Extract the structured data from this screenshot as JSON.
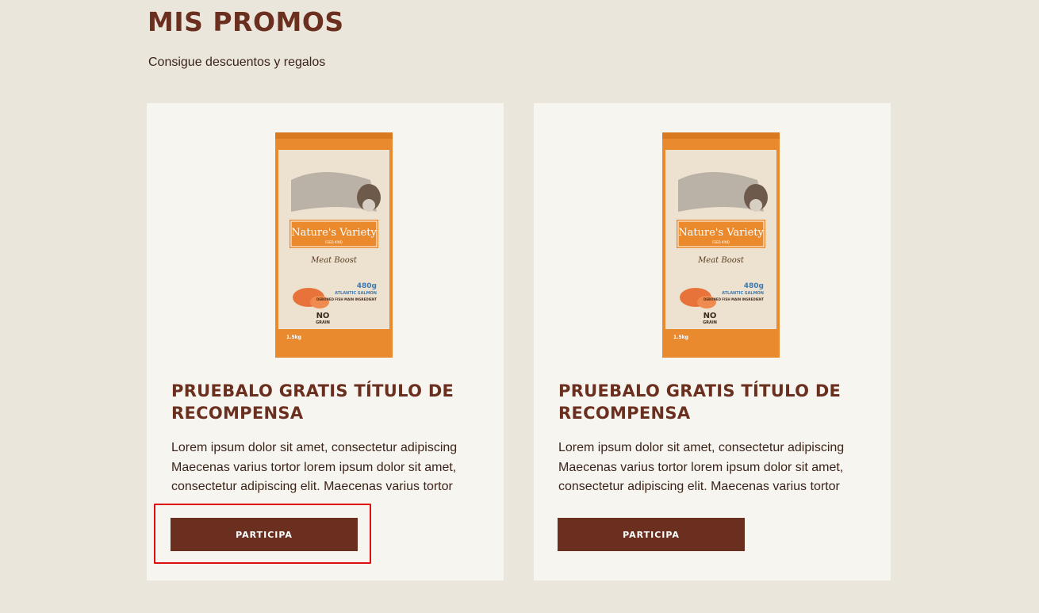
{
  "header": {
    "title": "MIS PROMOS",
    "subtitle": "Consigue descuentos y regalos"
  },
  "promos": [
    {
      "title": "PRUEBALO GRATIS TÍTULO DE RECOMPENSA",
      "description": "Lorem ipsum dolor sit amet, consectetur adipiscing Maecenas varius tortor lorem ipsum dolor sit amet, consectetur adipiscing elit. Maecenas varius tortor",
      "button_label": "PARTICIPA",
      "product": {
        "brand": "Nature's Variety",
        "sub_brand": "FEED KIND",
        "line": "Meat Boost",
        "weight": "480g",
        "protein": "ATLANTIC SALMON",
        "claim": "DEBONED FISH MAIN INGREDIENT",
        "no_grain_top": "NO",
        "no_grain_bottom": "GRAIN",
        "net": "1.5kg"
      }
    },
    {
      "title": "PRUEBALO GRATIS TÍTULO DE RECOMPENSA",
      "description": "Lorem ipsum dolor sit amet, consectetur adipiscing Maecenas varius tortor lorem ipsum dolor sit amet, consectetur adipiscing elit. Maecenas varius tortor",
      "button_label": "PARTICIPA",
      "product": {
        "brand": "Nature's Variety",
        "sub_brand": "FEED KIND",
        "line": "Meat Boost",
        "weight": "480g",
        "protein": "ATLANTIC SALMON",
        "claim": "DEBONED FISH MAIN INGREDIENT",
        "no_grain_top": "NO",
        "no_grain_bottom": "GRAIN",
        "net": "1.5kg"
      }
    }
  ],
  "colors": {
    "background": "#ebe6dc",
    "card": "#f7f5f0",
    "brand_brown": "#6b2f1f",
    "package_orange": "#e8862c",
    "highlight": "#e00f0f"
  }
}
